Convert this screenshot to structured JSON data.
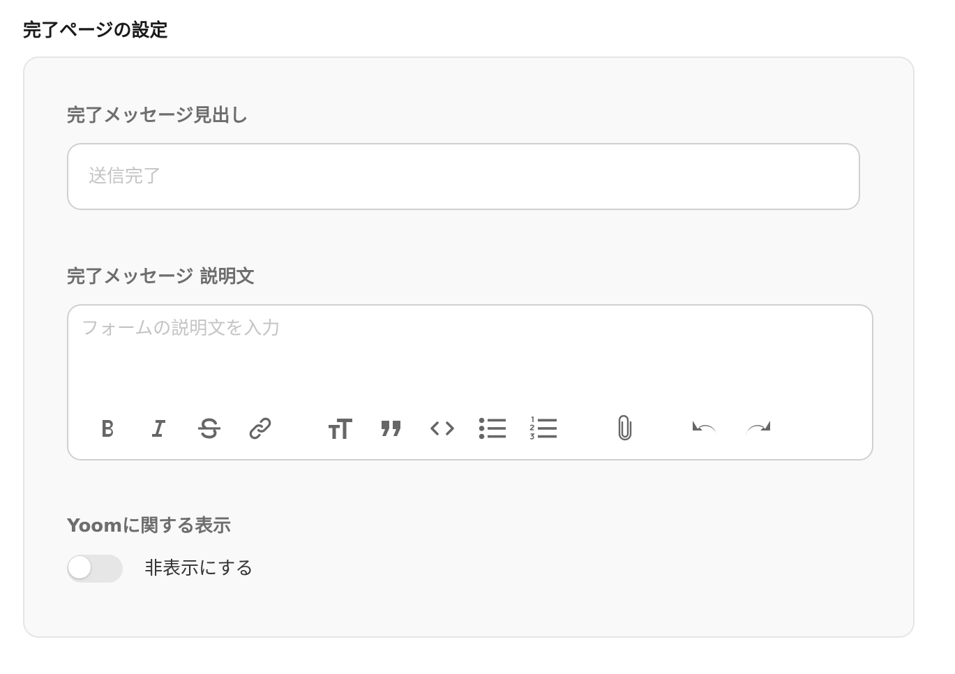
{
  "page": {
    "section_title": "完了ページの設定"
  },
  "heading_field": {
    "label": "完了メッセージ見出し",
    "value": "",
    "placeholder": "送信完了"
  },
  "description_field": {
    "label": "完了メッセージ 説明文",
    "placeholder": "フォームの説明文を入力",
    "toolbar": [
      {
        "name": "bold",
        "icon": "bold-icon"
      },
      {
        "name": "italic",
        "icon": "italic-icon"
      },
      {
        "name": "strikethrough",
        "icon": "strikethrough-icon"
      },
      {
        "name": "link",
        "icon": "link-icon"
      },
      {
        "name": "heading",
        "icon": "text-size-icon"
      },
      {
        "name": "quote",
        "icon": "quote-icon"
      },
      {
        "name": "code",
        "icon": "code-icon"
      },
      {
        "name": "bullet-list",
        "icon": "bullet-list-icon"
      },
      {
        "name": "numbered-list",
        "icon": "numbered-list-icon"
      },
      {
        "name": "attach",
        "icon": "paperclip-icon"
      },
      {
        "name": "undo",
        "icon": "undo-icon"
      },
      {
        "name": "redo",
        "icon": "redo-icon"
      }
    ]
  },
  "yoom_display": {
    "label": "Yoomに関する表示",
    "toggle_label": "非表示にする",
    "toggle_on": false
  },
  "colors": {
    "panel_bg": "#f9f9f9",
    "label": "#6d6d6d",
    "icon": "#666666",
    "placeholder": "#c4c4c4"
  }
}
